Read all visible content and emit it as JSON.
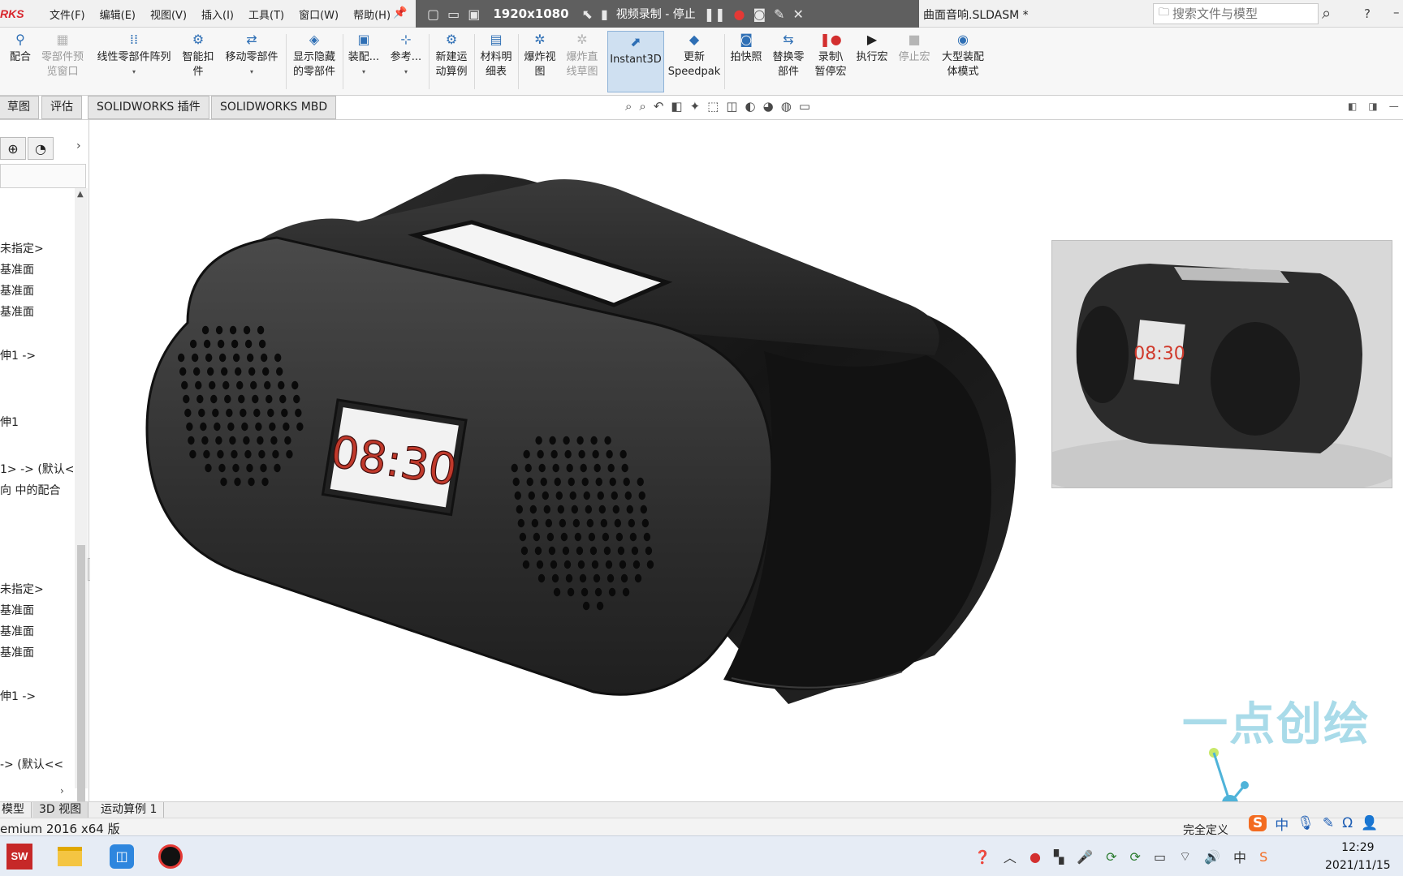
{
  "app": {
    "logo_text": "RKS",
    "document_title": "曲面音响.SLDASM *",
    "menu": [
      "文件(F)",
      "编辑(E)",
      "视图(V)",
      "插入(I)",
      "工具(T)",
      "窗口(W)",
      "帮助(H)"
    ],
    "quickbar": {
      "resolution": "1920x1080",
      "recording": "视频录制 - 停止"
    },
    "search_placeholder": "搜索文件与模型",
    "help": "?"
  },
  "ribbon": [
    {
      "label": "配合",
      "icon": "mate-icon",
      "enabled": true
    },
    {
      "label": "零部件预\n览窗口",
      "icon": "preview-window-icon",
      "enabled": false
    },
    {
      "label": "线性零部件阵列",
      "icon": "linear-pattern-icon",
      "enabled": true
    },
    {
      "label": "智能扣\n件",
      "icon": "smart-fastener-icon",
      "enabled": true
    },
    {
      "label": "移动零部件",
      "icon": "move-component-icon",
      "enabled": true
    },
    {
      "label": "显示隐藏\n的零部件",
      "icon": "show-hidden-icon",
      "enabled": true
    },
    {
      "label": "装配...",
      "icon": "assembly-feature-icon",
      "enabled": true
    },
    {
      "label": "参考...",
      "icon": "reference-geometry-icon",
      "enabled": true
    },
    {
      "label": "新建运\n动算例",
      "icon": "motion-study-icon",
      "enabled": true
    },
    {
      "label": "材料明\n细表",
      "icon": "bom-icon",
      "enabled": true
    },
    {
      "label": "爆炸视\n图",
      "icon": "exploded-view-icon",
      "enabled": true
    },
    {
      "label": "爆炸直\n线草图",
      "icon": "explode-line-icon",
      "enabled": false
    },
    {
      "label": "Instant3D",
      "icon": "instant3d-icon",
      "enabled": true,
      "active": true
    },
    {
      "label": "更新\nSpeedpak",
      "icon": "speedpak-icon",
      "enabled": true
    },
    {
      "label": "拍快照",
      "icon": "snapshot-icon",
      "enabled": true
    },
    {
      "label": "替换零\n部件",
      "icon": "replace-component-icon",
      "enabled": true
    },
    {
      "label": "录制\\\n暂停宏",
      "icon": "record-macro-icon",
      "enabled": true
    },
    {
      "label": "执行宏",
      "icon": "run-macro-icon",
      "enabled": true
    },
    {
      "label": "停止宏",
      "icon": "stop-macro-icon",
      "enabled": false
    },
    {
      "label": "大型装配\n体模式",
      "icon": "large-assembly-icon",
      "enabled": true
    }
  ],
  "command_tabs": [
    "草图",
    "评估",
    "SOLIDWORKS 插件",
    "SOLIDWORKS MBD"
  ],
  "tree_items": [
    "未指定>",
    "基准面",
    "基准面",
    "基准面",
    "伸1 ->",
    "伸1",
    "1> -> (默认<",
    "向 中的配合",
    "未指定>",
    "基准面",
    "基准面",
    "基准面",
    "伸1 ->",
    "-> (默认<<"
  ],
  "display": {
    "clock_face": "08:30",
    "render_clock": "08:30"
  },
  "watermark": "一点创绘",
  "bottom_tabs": [
    "模型",
    "3D 视图",
    "运动算例 1"
  ],
  "status": {
    "left": "emium 2016 x64 版",
    "right": "完全定义",
    "ime_mode": "中"
  },
  "taskbar": {
    "time": "12:29",
    "date": "2021/11/15"
  },
  "colors": {
    "accent": "#2e6fb5",
    "quickbar_bg": "#5f5f5f",
    "logo": "#d8262d",
    "speaker_body": "#1c1c1c",
    "display_digits": "#c0392b"
  }
}
